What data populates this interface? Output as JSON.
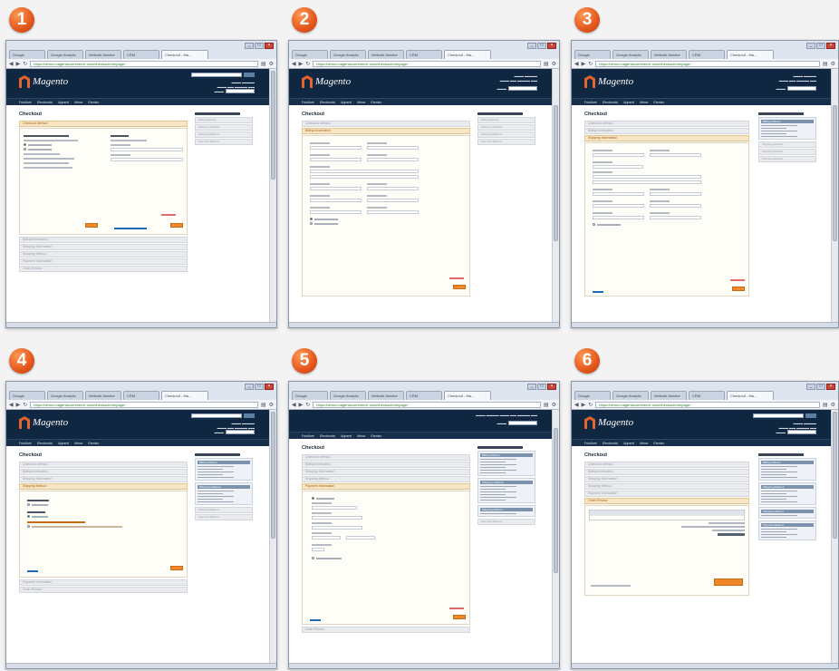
{
  "panels": [
    {
      "number": "1"
    },
    {
      "number": "2"
    },
    {
      "number": "3"
    },
    {
      "number": "4"
    },
    {
      "number": "5"
    },
    {
      "number": "6"
    }
  ],
  "browser": {
    "tabs": [
      "Google",
      "Google Analytic",
      "Website Monitor",
      "CRM",
      "Checkout - Ma..."
    ],
    "url": "https://demo.magentocommerce.com/checkout/onepage/"
  },
  "magento": {
    "logo_text": "Magento",
    "nav": [
      "Furniture",
      "Electronics",
      "Apparel",
      "Music",
      "Ebooks"
    ],
    "page_title": "Checkout",
    "steps": [
      "Checkout Method",
      "Billing Information",
      "Shipping Information",
      "Shipping Method",
      "Payment Information",
      "Order Review"
    ],
    "sidebar_title": "YOUR CHECKOUT PROGRESS",
    "sidebar_items": [
      "Billing Address",
      "Shipping Address",
      "Shipping Method",
      "Payment Method"
    ],
    "place_order": "Place Order",
    "continue": "Continue",
    "grand_total": "Grand Total"
  },
  "colors": {
    "accent": "#e4561b",
    "header": "#0f2740",
    "button": "#f08a2a"
  }
}
